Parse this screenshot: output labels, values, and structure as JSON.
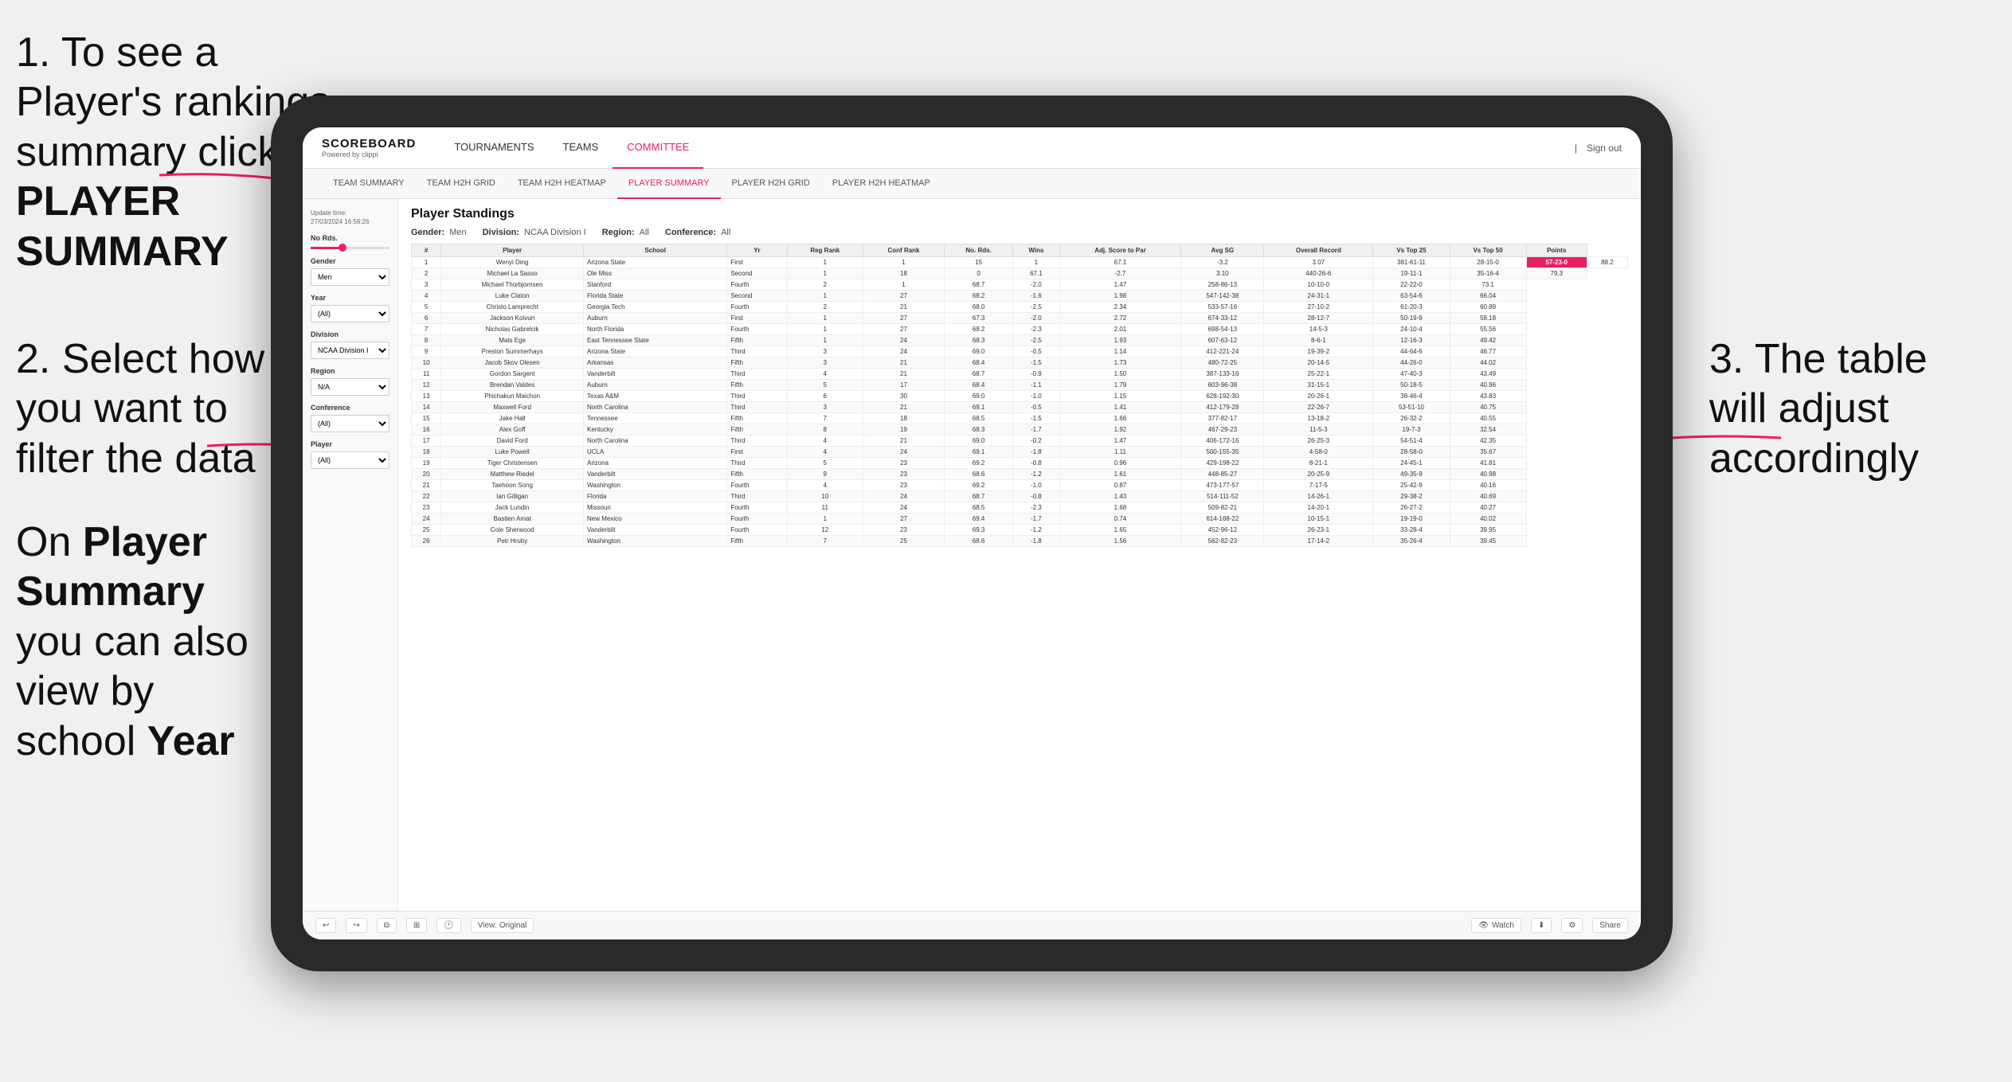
{
  "instructions": {
    "step1": "1. To see a Player's rankings summary click ",
    "step1_bold": "PLAYER SUMMARY",
    "step2_line1": "2. Select how you want to",
    "step2_line2": "filter the data",
    "step3": "3. The table will adjust accordingly",
    "bottom_line1": "On ",
    "bottom_bold": "Player Summary",
    "bottom_line2": " you can also view by school ",
    "bottom_bold2": "Year"
  },
  "header": {
    "logo": "SCOREBOARD",
    "logo_sub": "Powered by clippi",
    "nav": [
      "TOURNAMENTS",
      "TEAMS",
      "COMMITTEE"
    ],
    "active_nav": "COMMITTEE",
    "sign_out": "Sign out"
  },
  "sub_nav": {
    "items": [
      "TEAM SUMMARY",
      "TEAM H2H GRID",
      "TEAM H2H HEATMAP",
      "PLAYER SUMMARY",
      "PLAYER H2H GRID",
      "PLAYER H2H HEATMAP"
    ],
    "active": "PLAYER SUMMARY"
  },
  "sidebar": {
    "update_label": "Update time:",
    "update_time": "27/03/2024 16:56:26",
    "no_rds_label": "No Rds.",
    "gender_label": "Gender",
    "gender_value": "Men",
    "year_label": "Year",
    "year_value": "(All)",
    "division_label": "Division",
    "division_value": "NCAA Division I",
    "region_label": "Region",
    "region_value": "N/A",
    "conference_label": "Conference",
    "conference_value": "(All)",
    "player_label": "Player",
    "player_value": "(All)"
  },
  "table": {
    "title": "Player Standings",
    "gender_label": "Gender:",
    "gender_val": "Men",
    "division_label": "Division:",
    "division_val": "NCAA Division I",
    "region_label": "Region:",
    "region_val": "All",
    "conference_label": "Conference:",
    "conference_val": "All",
    "columns": [
      "#",
      "Player",
      "School",
      "Yr",
      "Reg Rank",
      "Conf Rank",
      "No. Rds.",
      "Wins",
      "Adj. Score to Par",
      "Avg SG",
      "Overall Record",
      "Vs Top 25",
      "Vs Top 50",
      "Points"
    ],
    "rows": [
      [
        "1",
        "Wenyi Ding",
        "Arizona State",
        "First",
        "1",
        "1",
        "15",
        "1",
        "67.1",
        "-3.2",
        "3.07",
        "381-61-11",
        "28-15-0",
        "57-23-0",
        "88.2"
      ],
      [
        "2",
        "Michael La Sasso",
        "Ole Miss",
        "Second",
        "1",
        "18",
        "0",
        "67.1",
        "-2.7",
        "3.10",
        "440-26-6",
        "19-11-1",
        "35-16-4",
        "79.3"
      ],
      [
        "3",
        "Michael Thorbjornsen",
        "Stanford",
        "Fourth",
        "2",
        "1",
        "68.7",
        "-2.0",
        "1.47",
        "258-86-13",
        "10-10-0",
        "22-22-0",
        "73.1"
      ],
      [
        "4",
        "Luke Claton",
        "Florida State",
        "Second",
        "1",
        "27",
        "68.2",
        "-1.6",
        "1.98",
        "547-142-38",
        "24-31-1",
        "63-54-6",
        "66.04"
      ],
      [
        "5",
        "Christo Lamprecht",
        "Georgia Tech",
        "Fourth",
        "2",
        "21",
        "68.0",
        "-2.5",
        "2.34",
        "533-57-16",
        "27-10-2",
        "61-20-3",
        "60.89"
      ],
      [
        "6",
        "Jackson Koivun",
        "Auburn",
        "First",
        "1",
        "27",
        "67.3",
        "-2.0",
        "2.72",
        "674-33-12",
        "28-12-7",
        "50-19-9",
        "58.18"
      ],
      [
        "7",
        "Nicholas Gabrelcik",
        "North Florida",
        "Fourth",
        "1",
        "27",
        "68.2",
        "-2.3",
        "2.01",
        "698-54-13",
        "14-5-3",
        "24-10-4",
        "55.56"
      ],
      [
        "8",
        "Mats Ege",
        "East Tennessee State",
        "Fifth",
        "1",
        "24",
        "68.3",
        "-2.5",
        "1.93",
        "607-63-12",
        "8-6-1",
        "12-16-3",
        "49.42"
      ],
      [
        "9",
        "Preston Summerhays",
        "Arizona State",
        "Third",
        "3",
        "24",
        "69.0",
        "-0.5",
        "1.14",
        "412-221-24",
        "19-39-2",
        "44-64-6",
        "46.77"
      ],
      [
        "10",
        "Jacob Skov Olesen",
        "Arkansas",
        "Fifth",
        "3",
        "21",
        "68.4",
        "-1.5",
        "1.73",
        "480-72-25",
        "20-14-5",
        "44-26-0",
        "44.02"
      ],
      [
        "11",
        "Gordon Sargent",
        "Vanderbilt",
        "Third",
        "4",
        "21",
        "68.7",
        "-0.9",
        "1.50",
        "387-133-16",
        "25-22-1",
        "47-40-3",
        "43.49"
      ],
      [
        "12",
        "Brendan Valdes",
        "Auburn",
        "Fifth",
        "5",
        "17",
        "68.4",
        "-1.1",
        "1.79",
        "603-96-38",
        "31-15-1",
        "50-18-5",
        "40.96"
      ],
      [
        "13",
        "Phichakun Maichon",
        "Texas A&M",
        "Third",
        "6",
        "30",
        "69.0",
        "-1.0",
        "1.15",
        "628-192-30",
        "20-26-1",
        "38-46-4",
        "43.83"
      ],
      [
        "14",
        "Maxwell Ford",
        "North Carolina",
        "Third",
        "3",
        "21",
        "69.1",
        "-0.5",
        "1.41",
        "412-179-28",
        "22-26-7",
        "53-51-10",
        "40.75"
      ],
      [
        "15",
        "Jake Hall",
        "Tennessee",
        "Fifth",
        "7",
        "18",
        "68.5",
        "-1.5",
        "1.66",
        "377-82-17",
        "13-18-2",
        "26-32-2",
        "40.55"
      ],
      [
        "16",
        "Alex Goff",
        "Kentucky",
        "Fifth",
        "8",
        "19",
        "68.3",
        "-1.7",
        "1.92",
        "467-29-23",
        "11-5-3",
        "19-7-3",
        "32.54"
      ],
      [
        "17",
        "David Ford",
        "North Carolina",
        "Third",
        "4",
        "21",
        "69.0",
        "-0.2",
        "1.47",
        "406-172-16",
        "26-25-3",
        "54-51-4",
        "42.35"
      ],
      [
        "18",
        "Luke Powell",
        "UCLA",
        "First",
        "4",
        "24",
        "69.1",
        "-1.8",
        "1.11",
        "500-155-35",
        "4-58-0",
        "28-58-0",
        "35.67"
      ],
      [
        "19",
        "Tiger Christensen",
        "Arizona",
        "Third",
        "5",
        "23",
        "69.2",
        "-0.8",
        "0.96",
        "429-198-22",
        "8-21-1",
        "24-45-1",
        "41.81"
      ],
      [
        "20",
        "Matthew Riedel",
        "Vanderbilt",
        "Fifth",
        "9",
        "23",
        "68.6",
        "-1.2",
        "1.61",
        "448-85-27",
        "20-25-9",
        "49-35-9",
        "40.98"
      ],
      [
        "21",
        "Taehoon Song",
        "Washington",
        "Fourth",
        "4",
        "23",
        "69.2",
        "-1.0",
        "0.87",
        "473-177-57",
        "7-17-5",
        "25-42-9",
        "40.16"
      ],
      [
        "22",
        "Ian Gilligan",
        "Florida",
        "Third",
        "10",
        "24",
        "68.7",
        "-0.8",
        "1.43",
        "514-111-52",
        "14-26-1",
        "29-38-2",
        "40.69"
      ],
      [
        "23",
        "Jack Lundin",
        "Missouri",
        "Fourth",
        "11",
        "24",
        "68.5",
        "-2.3",
        "1.68",
        "509-82-21",
        "14-20-1",
        "26-27-2",
        "40.27"
      ],
      [
        "24",
        "Bastien Amat",
        "New Mexico",
        "Fourth",
        "1",
        "27",
        "69.4",
        "-1.7",
        "0.74",
        "614-168-22",
        "10-15-1",
        "19-19-0",
        "40.02"
      ],
      [
        "25",
        "Cole Sherwood",
        "Vanderbilt",
        "Fourth",
        "12",
        "23",
        "69.3",
        "-1.2",
        "1.65",
        "452-96-12",
        "26-23-1",
        "33-28-4",
        "39.95"
      ],
      [
        "26",
        "Petr Hruby",
        "Washington",
        "Fifth",
        "7",
        "25",
        "68.6",
        "-1.8",
        "1.56",
        "562-82-23",
        "17-14-2",
        "35-26-4",
        "39.45"
      ]
    ]
  },
  "toolbar": {
    "view_label": "View: Original",
    "watch_label": "Watch",
    "share_label": "Share"
  }
}
